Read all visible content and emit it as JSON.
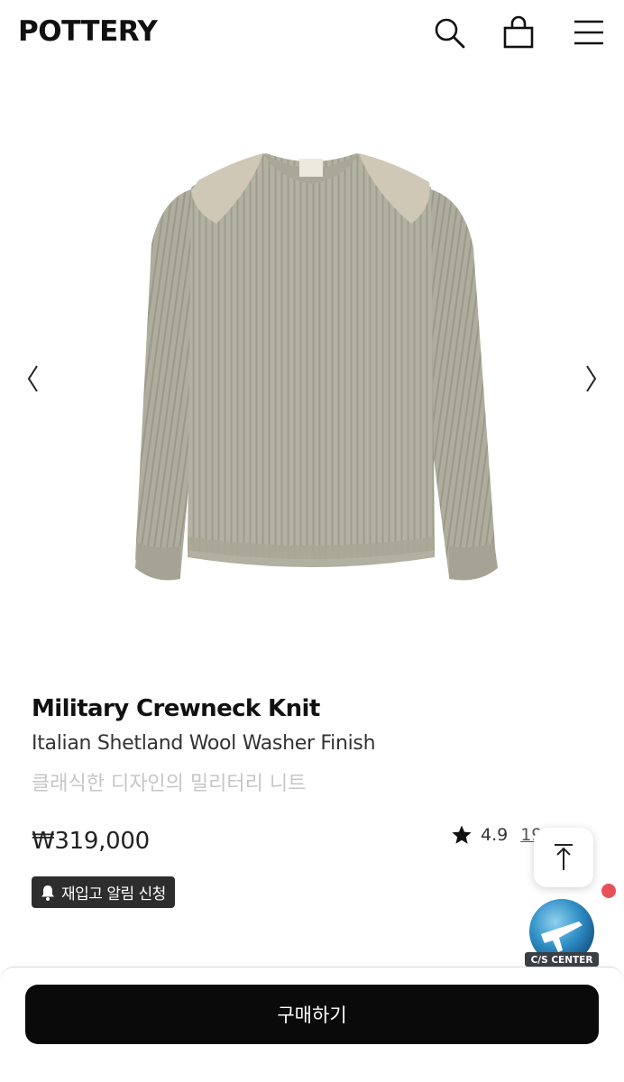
{
  "header": {
    "logo": "POTTERY",
    "icons": [
      "search-icon",
      "shopping-bag-icon",
      "hamburger-menu-icon"
    ]
  },
  "gallery": {
    "image": "sweater-product-photo",
    "prev_icon": "chevron-left-icon",
    "next_icon": "chevron-right-icon"
  },
  "product": {
    "title": "Military Crewneck Knit",
    "subtitle": "Italian Shetland Wool Washer Finish",
    "description": "클래식한 디자인의 밀리터리 니트",
    "price": "₩319,000",
    "rating": "4.9",
    "review_count": "19"
  },
  "restock": {
    "label": "재입고 알림 신청",
    "icon": "bell-icon"
  },
  "floating": {
    "top_icon": "arrow-up-icon",
    "cs_label": "C/S CENTER"
  },
  "bottom": {
    "buy_label": "구매하기"
  },
  "colors": {
    "buy_button": "#0a0a0a",
    "restock_badge": "#2d2d2d",
    "notification_dot": "#e8515a",
    "description_text": "#c6c6c6",
    "sweater": "#b3b2a2",
    "shoulder_patch": "#cfc8b6"
  }
}
